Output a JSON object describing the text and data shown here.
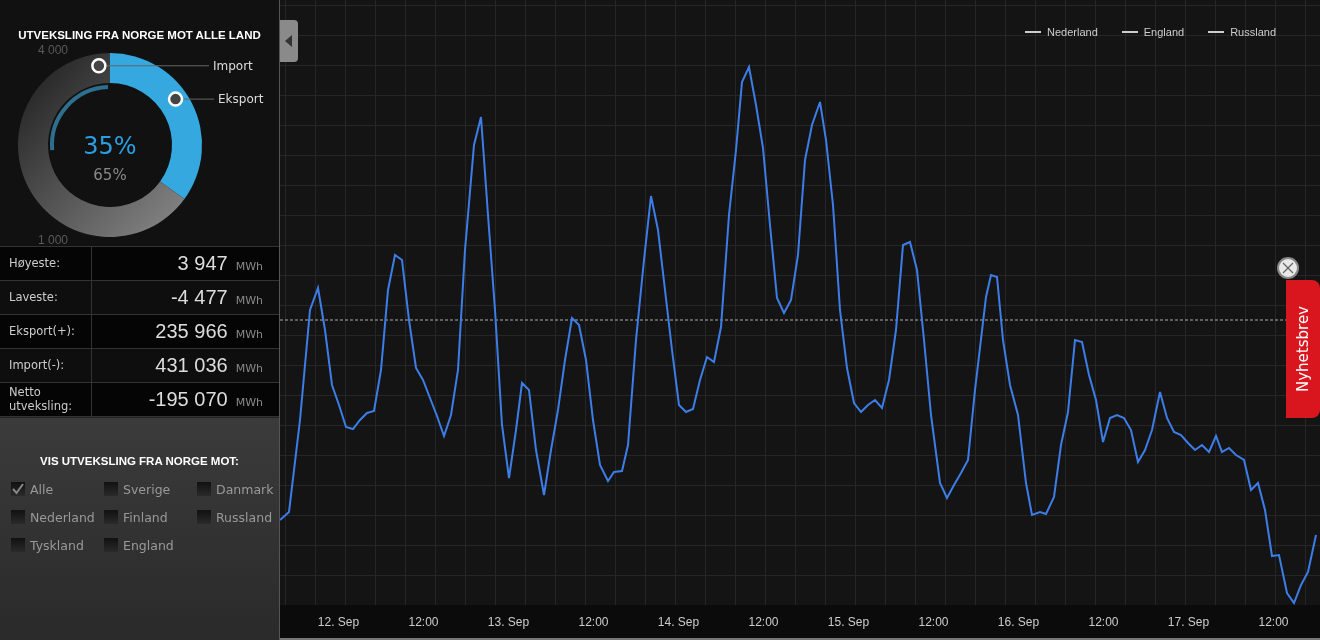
{
  "summary": {
    "chart_data": {
      "type": "donut",
      "title": "UTVEKSLING FRA NORGE MOT ALLE LAND",
      "categories": [
        "Import",
        "Eksport"
      ],
      "values": [
        65,
        35
      ]
    },
    "axis_labels": [
      "4 000",
      "1 000"
    ],
    "center_primary": "35%",
    "center_secondary": "65%"
  },
  "stats": [
    {
      "label": "Høyeste:",
      "value": "3 947",
      "unit": "MWh"
    },
    {
      "label": "Laveste:",
      "value": "-4 477",
      "unit": "MWh"
    },
    {
      "label": "Eksport(+):",
      "value": "235 966",
      "unit": "MWh"
    },
    {
      "label": "Import(-):",
      "value": "431 036",
      "unit": "MWh"
    },
    {
      "label": "Netto utveksling:",
      "value": "-195 070",
      "unit": "MWh"
    }
  ],
  "filter": {
    "title": "VIS UTVEKSLING FRA NORGE MOT:",
    "options": [
      {
        "label": "Alle",
        "checked": true
      },
      {
        "label": "Sverige",
        "checked": false
      },
      {
        "label": "Danmark",
        "checked": false
      },
      {
        "label": "Nederland",
        "checked": false
      },
      {
        "label": "Finland",
        "checked": false
      },
      {
        "label": "Russland",
        "checked": false
      },
      {
        "label": "Tyskland",
        "checked": false
      },
      {
        "label": "England",
        "checked": false
      }
    ]
  },
  "chart": {
    "legend": [
      {
        "label": "Nederland"
      },
      {
        "label": "England"
      },
      {
        "label": "Russland"
      }
    ],
    "x_labels": [
      "12. Sep",
      "12:00",
      "13. Sep",
      "12:00",
      "14. Sep",
      "12:00",
      "15. Sep",
      "12:00",
      "16. Sep",
      "12:00",
      "17. Sep",
      "12:00"
    ]
  },
  "newsletter": {
    "label": "Nyhetsbrev"
  }
}
